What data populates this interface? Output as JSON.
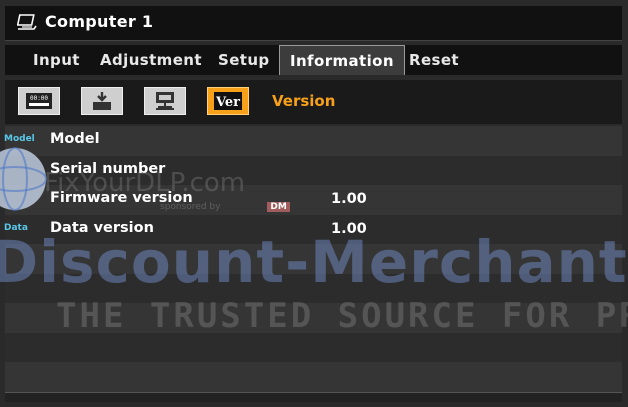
{
  "window": {
    "title": "Computer 1",
    "icon": "computer-input-icon"
  },
  "tabs": [
    {
      "label": "Input",
      "active": false
    },
    {
      "label": "Adjustment",
      "active": false
    },
    {
      "label": "Setup",
      "active": false
    },
    {
      "label": "Information",
      "active": true
    },
    {
      "label": "Reset",
      "active": false
    }
  ],
  "subtabs": {
    "items": [
      {
        "icon": "usage-time-icon",
        "glyph": "00:00",
        "active": false
      },
      {
        "icon": "source-icon",
        "active": false
      },
      {
        "icon": "lan-icon",
        "active": false
      },
      {
        "icon": "version-icon",
        "glyph": "Ver",
        "active": true
      }
    ],
    "current_label": "Version"
  },
  "rows": [
    {
      "tag": "Model",
      "label": "Model",
      "value": ""
    },
    {
      "tag": "",
      "label": "Serial number",
      "value": ""
    },
    {
      "tag": "",
      "label": "Firmware version",
      "value": "1.00"
    },
    {
      "tag": "Data",
      "label": "Data version",
      "value": "1.00"
    },
    {
      "tag": "",
      "label": "",
      "value": ""
    },
    {
      "tag": "",
      "label": "",
      "value": ""
    },
    {
      "tag": "",
      "label": "",
      "value": ""
    },
    {
      "tag": "",
      "label": "",
      "value": ""
    },
    {
      "tag": "",
      "label": "",
      "value": ""
    }
  ],
  "watermarks": {
    "site": "FixYourDLP.com",
    "sponsor": "sponsored by",
    "sponsor_badge": "DM",
    "brand": "Discount-Merchant.",
    "tagline": "THE TRUSTED SOURCE FOR PROJE"
  },
  "colors": {
    "accent": "#f7a01a",
    "tag": "#59c7e8"
  }
}
